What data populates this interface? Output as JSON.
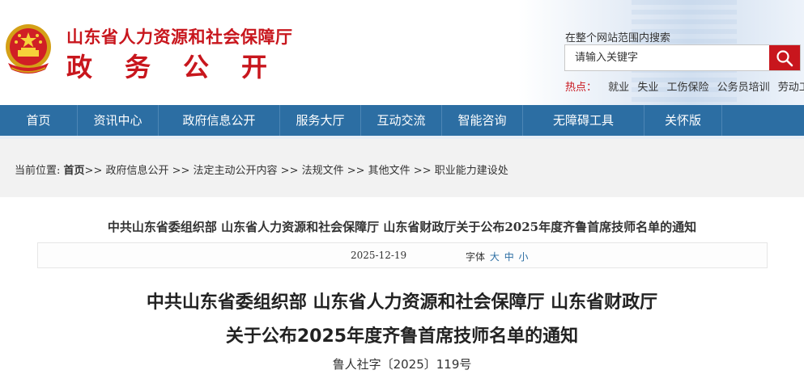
{
  "header": {
    "title": "山东省人力资源和社会保障厅",
    "subtitle": "政务公开",
    "search_label": "在整个网站范围内搜索",
    "search_placeholder": "请输入关键字",
    "hot_label": "热点：",
    "hot_items": [
      "就业",
      "失业",
      "工伤保险",
      "公务员培训",
      "劳动工资"
    ]
  },
  "nav": {
    "items": [
      "首页",
      "资讯中心",
      "政府信息公开",
      "服务大厅",
      "互动交流",
      "智能咨询",
      "无障碍工具",
      "关怀版"
    ]
  },
  "breadcrumb": {
    "prefix": "当前位置:",
    "home": "首页",
    "path": [
      ">> 政府信息公开",
      ">> 法定主动公开内容",
      ">> 法规文件",
      ">> 其他文件",
      ">> 职业能力建设处"
    ]
  },
  "article": {
    "header_title": "中共山东省委组织部 山东省人力资源和社会保障厅 山东省财政厅关于公布2025年度齐鲁首席技师名单的通知",
    "date": "2025-12-19",
    "font_label": "字体",
    "font_sizes": [
      "大",
      "中",
      "小"
    ],
    "title_line1": "中共山东省委组织部 山东省人力资源和社会保障厅 山东省财政厅",
    "title_line2": "关于公布2025年度齐鲁首席技师名单的通知",
    "doc_number": "鲁人社字〔2025〕119号"
  },
  "colors": {
    "brand_red": "#c8161d",
    "nav_blue": "#2c6ea3",
    "crumb_bg": "#f2f2f2"
  }
}
